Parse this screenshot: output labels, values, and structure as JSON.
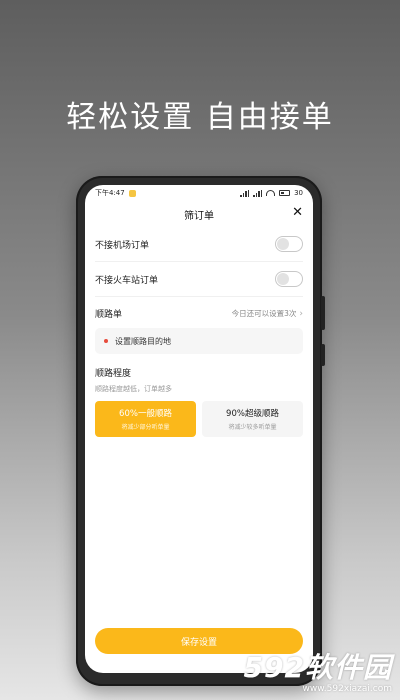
{
  "headline": "轻松设置 自由接单",
  "statusbar": {
    "time": "下午4:47",
    "battery": "30"
  },
  "dialog": {
    "title": "筛订单",
    "close": "✕"
  },
  "filters": [
    {
      "label": "不接机场订单",
      "on": false
    },
    {
      "label": "不接火车站订单",
      "on": false
    }
  ],
  "route": {
    "title": "顺路单",
    "limit_text": "今日还可以设置3次",
    "chevron": "›",
    "destination_placeholder": "设置顺路目的地"
  },
  "degree": {
    "title": "顺路程度",
    "subtitle": "顺路程度越低，订单越多",
    "options": [
      {
        "main": "60%一般顺路",
        "sub": "将减少部分听单量",
        "selected": true
      },
      {
        "main": "90%超级顺路",
        "sub": "将减少较多听单量",
        "selected": false
      }
    ]
  },
  "save_label": "保存设置",
  "watermark": {
    "logo": "592软件园",
    "url": "www.592xiazai.com"
  },
  "colors": {
    "accent": "#fbb81a",
    "dot": "#e74c3c"
  }
}
